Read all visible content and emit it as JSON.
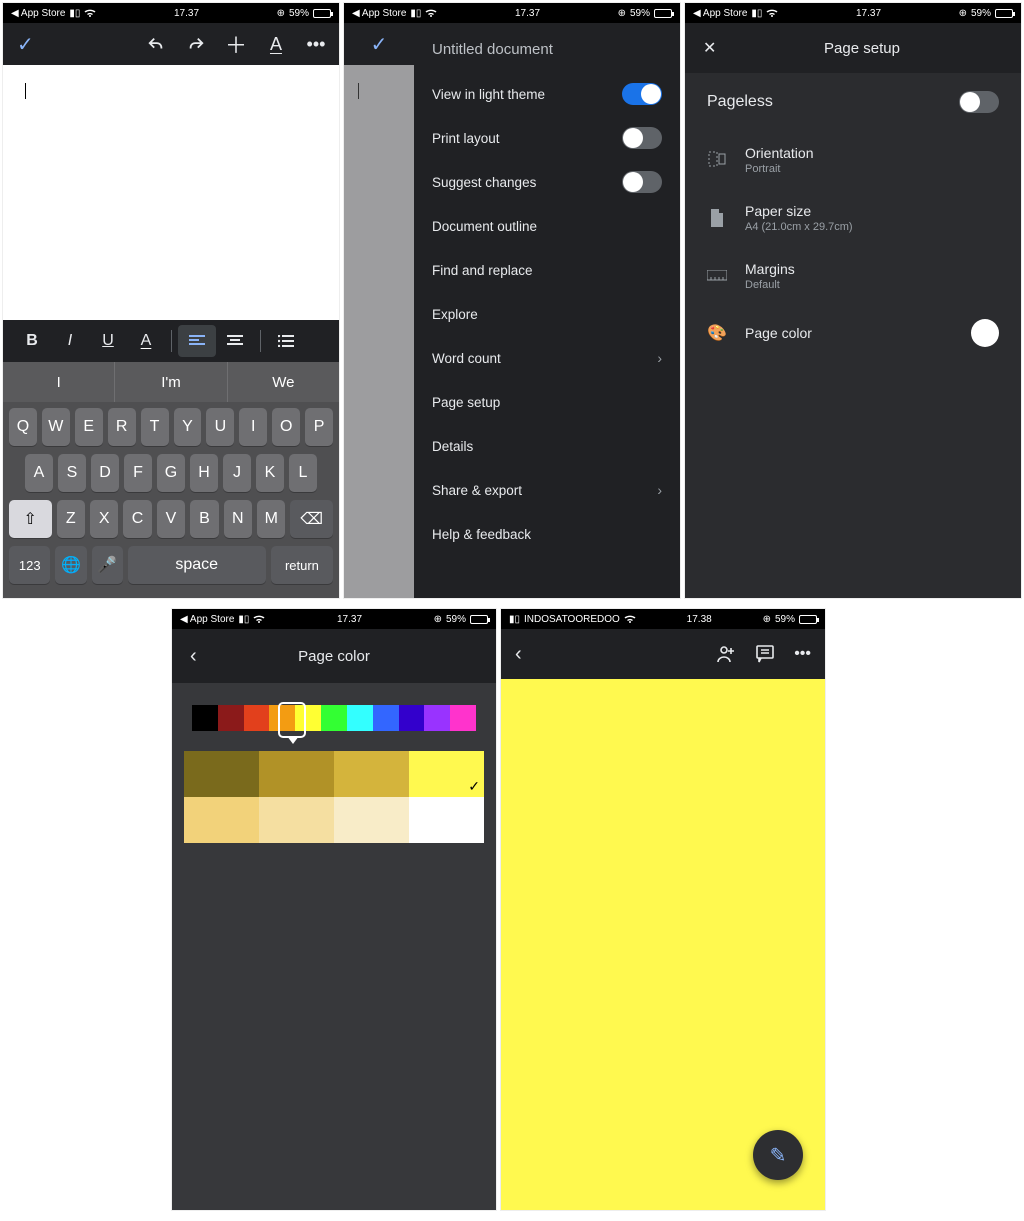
{
  "status": {
    "back_app": "App Store",
    "time": "17.37",
    "battery_pct": "59%",
    "carrier": "INDOSATOOREDOO",
    "time2": "17.38"
  },
  "s1": {
    "suggestions": [
      "I",
      "I'm",
      "We"
    ],
    "keyboard": {
      "row1": [
        "Q",
        "W",
        "E",
        "R",
        "T",
        "Y",
        "U",
        "I",
        "O",
        "P"
      ],
      "row2": [
        "A",
        "S",
        "D",
        "F",
        "G",
        "H",
        "J",
        "K",
        "L"
      ],
      "row3": [
        "Z",
        "X",
        "C",
        "V",
        "B",
        "N",
        "M"
      ],
      "shift": "⇧",
      "backspace": "⌫",
      "numbers": "123",
      "space": "space",
      "return": "return"
    }
  },
  "s2": {
    "title": "Untitled document",
    "items": {
      "light": "View in light theme",
      "print": "Print layout",
      "suggest": "Suggest changes",
      "outline": "Document outline",
      "find": "Find and replace",
      "explore": "Explore",
      "wordcount": "Word count",
      "pagesetup": "Page setup",
      "details": "Details",
      "share": "Share & export",
      "help": "Help & feedback"
    }
  },
  "s3": {
    "title": "Page setup",
    "pageless": "Pageless",
    "orientation": {
      "label": "Orientation",
      "value": "Portrait"
    },
    "paper": {
      "label": "Paper size",
      "value": "A4 (21.0cm x 29.7cm)"
    },
    "margins": {
      "label": "Margins",
      "value": "Default"
    },
    "pagecolor": "Page color"
  },
  "s4": {
    "title": "Page color",
    "hue": [
      "#000000",
      "#8b1a1a",
      "#e2401c",
      "#f39c12",
      "#ffff33",
      "#33ff33",
      "#33ffff",
      "#3366ff",
      "#3300cc",
      "#9933ff",
      "#ff33cc"
    ],
    "shades": [
      "#7a6a1c",
      "#b19227",
      "#d4b43c",
      "#fff94f",
      "#f2d27a",
      "#f5dfa1",
      "#f8ecc8",
      "#ffffff"
    ],
    "selected_shade_index": 3
  }
}
